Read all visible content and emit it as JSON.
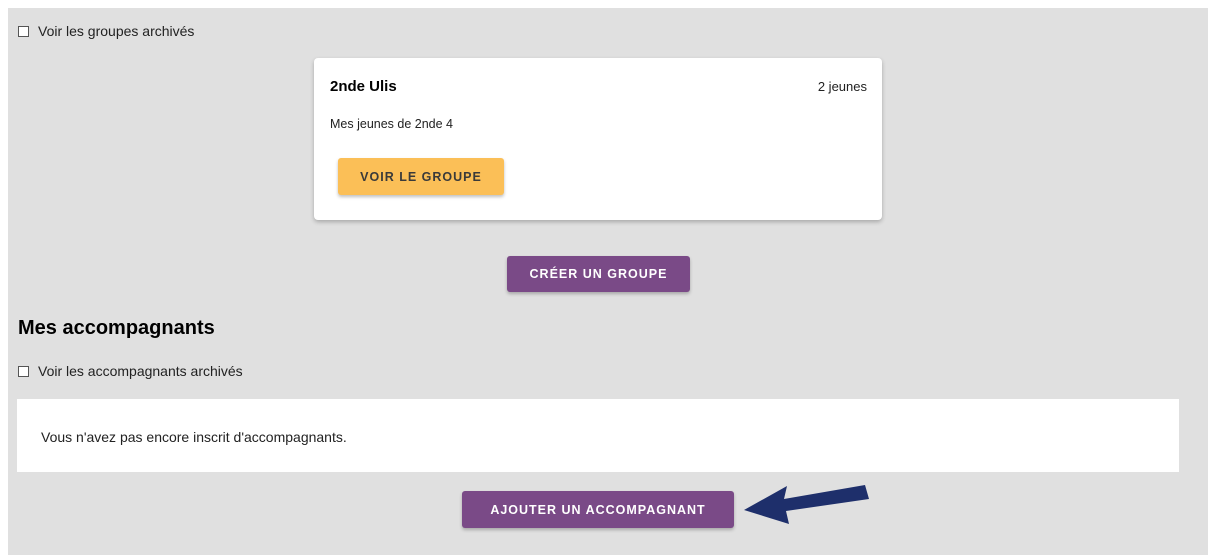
{
  "groups": {
    "archived_checkbox_label": "Voir les groupes archivés",
    "card": {
      "title": "2nde Ulis",
      "count": "2 jeunes",
      "description": "Mes jeunes de 2nde 4",
      "view_button": "VOIR LE GROUPE"
    },
    "create_button": "CRÉER UN GROUPE"
  },
  "companions": {
    "title": "Mes accompagnants",
    "archived_checkbox_label": "Voir les accompagnants archivés",
    "empty_message": "Vous n'avez pas encore inscrit d'accompagnants.",
    "add_button": "AJOUTER UN ACCOMPAGNANT"
  },
  "colors": {
    "background": "#e0e0e0",
    "primary_purple": "#7a4a87",
    "accent_yellow": "#fbbf57",
    "arrow": "#1e2f6b"
  },
  "annotation": {
    "arrow_icon": "arrow-left-icon"
  }
}
